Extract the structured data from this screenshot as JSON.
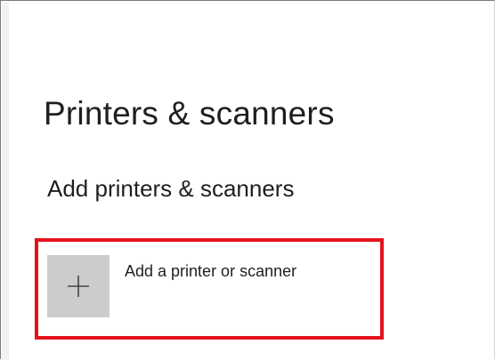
{
  "page": {
    "title": "Printers & scanners"
  },
  "section": {
    "heading": "Add printers & scanners"
  },
  "add_device": {
    "label": "Add a printer or scanner",
    "icon": "plus-icon"
  },
  "colors": {
    "highlight": "#e3121c",
    "tile": "#cccccc",
    "text": "#1f1f1f"
  }
}
